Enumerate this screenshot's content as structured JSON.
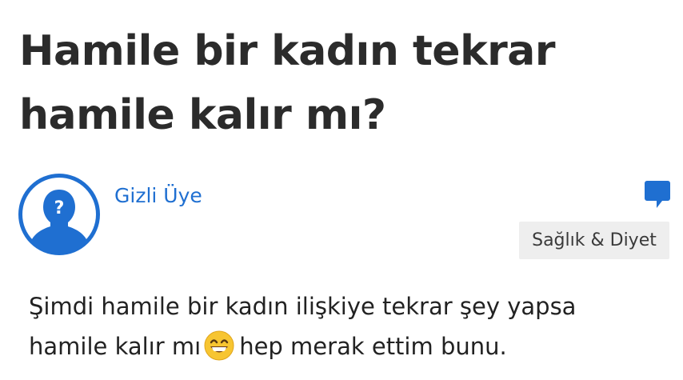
{
  "question": {
    "title": "Hamile bir kadın tekrar hamile kalır mı?",
    "text_before_emoji": "Şimdi hamile bir kadın ilişkiye tekrar şey yapsa hamile kalır mı",
    "emoji_icon": "grinning-face-with-smiling-eyes-icon",
    "text_after_emoji": "hep merak ettim bunu."
  },
  "author": {
    "name": "Gizli Üye",
    "avatar_icon": "anonymous-user-icon",
    "avatar_mark": "?"
  },
  "category": {
    "label": "Sağlık & Diyet"
  },
  "icons": {
    "comment": "comment-icon"
  },
  "colors": {
    "accent": "#1f6fd1",
    "title": "#2b2b2b",
    "text": "#222222",
    "badge_bg": "#eeeeee",
    "emoji_face": "#f7c531"
  }
}
